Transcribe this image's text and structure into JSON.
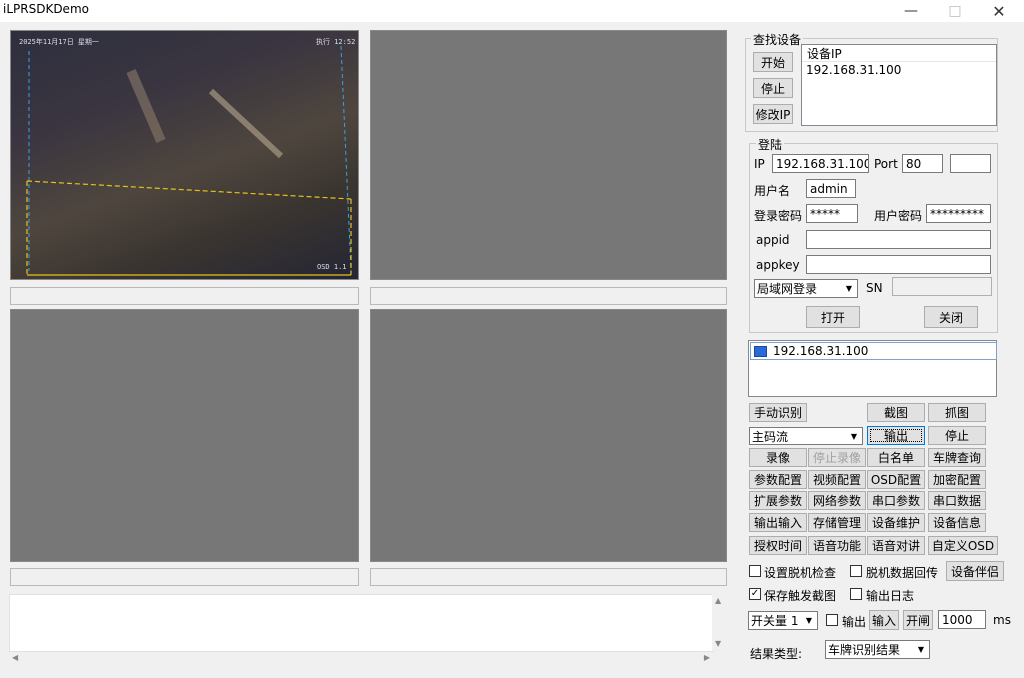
{
  "window": {
    "title": "iLPRSDKDemo"
  },
  "video": {
    "overlay_time": "2025年11月17日 星期一",
    "overlay_top_right": "执行 12:52",
    "overlay_bottom_right": "OSD 1.1"
  },
  "find_device": {
    "group_label": "查找设备",
    "start_label": "开始",
    "stop_label": "停止",
    "modify_ip_label": "修改IP",
    "list_header": "设备IP",
    "devices": [
      "192.168.31.100"
    ]
  },
  "login": {
    "group_label": "登陆",
    "ip_label": "IP",
    "ip_value": "192.168.31.100",
    "port_label": "Port",
    "port_value": "80",
    "username_label": "用户名",
    "username_value": "admin",
    "login_pwd_label": "登录密码",
    "login_pwd_value": "*****",
    "user_pwd_label": "用户密码",
    "user_pwd_value": "*********",
    "appid_label": "appid",
    "appkey_label": "appkey",
    "mode_value": "局域网登录",
    "sn_label": "SN",
    "open_label": "打开",
    "close_label": "关闭"
  },
  "device_tree": {
    "items": [
      "192.168.31.100"
    ]
  },
  "buttons": {
    "manual_recognize": "手动识别",
    "screenshot": "截图",
    "capture": "抓图",
    "stream_select": "主码流",
    "output": "输出",
    "stop": "停止",
    "record": "录像",
    "stop_record": "停止录像",
    "whitelist": "白名单",
    "plate_query": "车牌查询",
    "param_config": "参数配置",
    "video_config": "视频配置",
    "osd_config": "OSD配置",
    "encrypt_config": "加密配置",
    "ext_param": "扩展参数",
    "net_param": "网络参数",
    "serial_param": "串口参数",
    "serial_data": "串口数据",
    "io": "输出输入",
    "storage": "存储管理",
    "maintain": "设备维护",
    "device_info": "设备信息",
    "auth_time": "授权时间",
    "voice": "语音功能",
    "intercom": "语音对讲",
    "custom_osd": "自定义OSD",
    "device_partner": "设备伴侣"
  },
  "options": {
    "offline_check": "设置脱机检查",
    "offline_check_checked": false,
    "offline_data_return": "脱机数据回传",
    "offline_data_return_checked": false,
    "save_trigger_img": "保存触发截图",
    "save_trigger_img_checked": true,
    "output_log": "输出日志",
    "output_log_checked": false
  },
  "io_row": {
    "switch_value": "开关量 1",
    "output_label": "输出",
    "input_label": "输入",
    "open_gate_label": "开闸",
    "ms_value": "1000",
    "ms_unit": "ms"
  },
  "result": {
    "label": "结果类型:",
    "value": "车牌识别结果"
  }
}
